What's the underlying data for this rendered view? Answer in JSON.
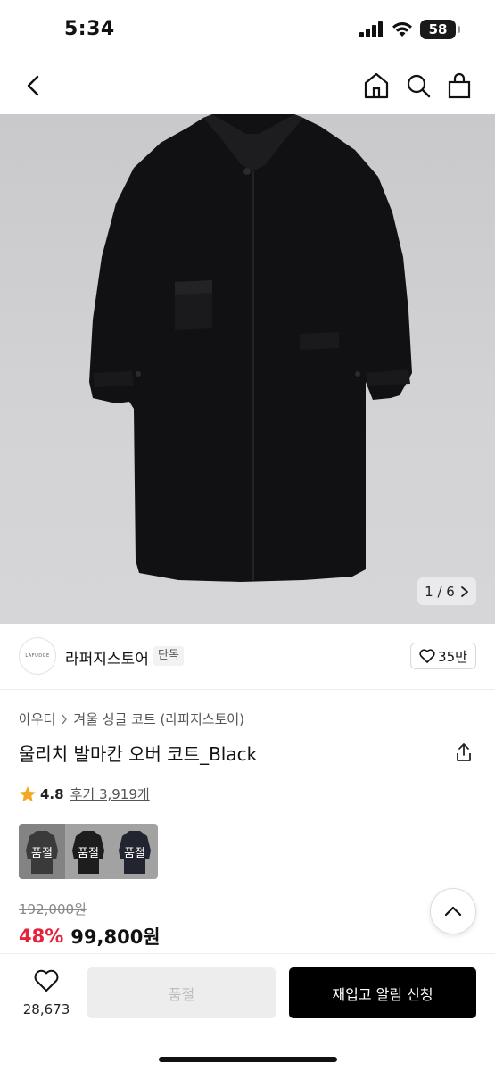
{
  "status_bar": {
    "time": "5:34",
    "battery": "58"
  },
  "nav": {
    "back_icon": "chevron-left-icon",
    "home_icon": "home-icon",
    "search_icon": "search-icon",
    "bag_icon": "shopping-bag-icon"
  },
  "hero": {
    "page_indicator": "1 / 6"
  },
  "store": {
    "logo_text": "LAFUDGE",
    "name": "라퍼지스토어",
    "tag": "단독",
    "likes": "35만"
  },
  "product": {
    "breadcrumb": [
      "아우터",
      "겨울 싱글 코트 (라퍼지스토어)"
    ],
    "title": "울리치 발마칸 오버 코트_Black",
    "rating": "4.8",
    "reviews": "후기 3,919개",
    "swatches": [
      {
        "label": "품절",
        "color": "#3a3a3a"
      },
      {
        "label": "품절",
        "color": "#0d0d0d"
      },
      {
        "label": "품절",
        "color": "#141a2a"
      }
    ],
    "original_price": "192,000원",
    "discount": "48%",
    "final_price": "99,800원"
  },
  "bottom_bar": {
    "wish_count": "28,673",
    "soldout_label": "품절",
    "restock_label": "재입고 알림 신청"
  },
  "colors": {
    "accent_red": "#e4223b",
    "star": "#f5a623"
  }
}
